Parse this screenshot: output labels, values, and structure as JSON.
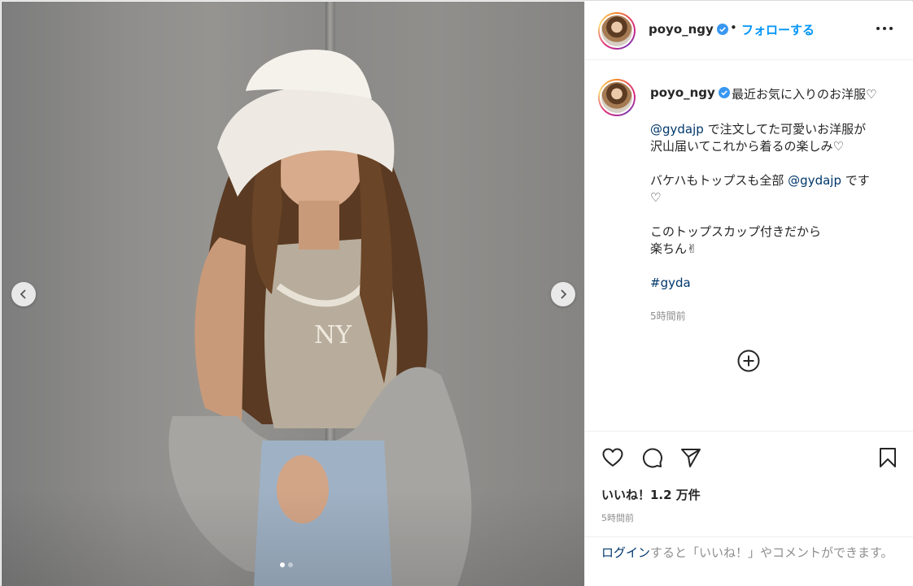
{
  "post": {
    "username": "poyo_ngy",
    "separator": "•",
    "follow_label": "フォローする",
    "caption_first_line": "最近お気に入りのお洋服♡",
    "caption": {
      "mention1": "@gydajp",
      "line2_rest": " で注文してた可愛いお洋服が",
      "line3": "沢山届いてこれから着るの楽しみ♡",
      "line4_pre": "バケハもトップスも全部 ",
      "mention2": "@gydajp",
      "line4_post": " です",
      "line5": "♡",
      "line6": "このトップスカップ付きだから",
      "line7": "楽ちん✌︎",
      "hashtag": "#gyda"
    },
    "caption_time": "5時間前",
    "likes_label": "いいね！1.2 万件",
    "post_time": "5時間前"
  },
  "login_prompt": {
    "link_text": "ログイン",
    "rest_text": "すると「いいね！」やコメントができます。"
  },
  "carousel": {
    "total": 2,
    "active_index": 0
  },
  "icons": {
    "verified": "verified-badge-icon",
    "more": "more-options-icon",
    "like": "heart-icon",
    "comment": "comment-icon",
    "share": "share-icon",
    "save": "bookmark-icon",
    "add_comments": "plus-circle-icon"
  },
  "colors": {
    "accent_blue": "#0095f6",
    "verified_blue": "#3897f0",
    "link_dark": "#00376b",
    "text_primary": "#262626",
    "text_secondary": "#8e8e8e"
  }
}
